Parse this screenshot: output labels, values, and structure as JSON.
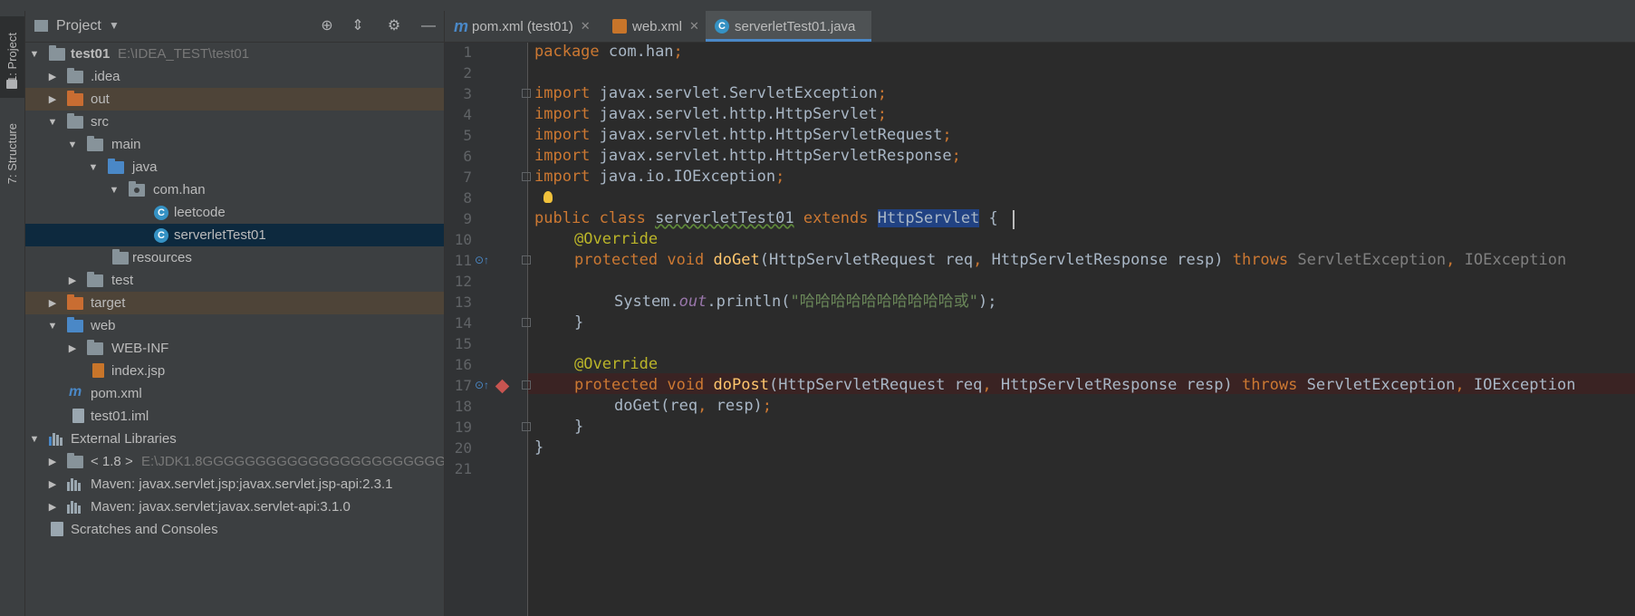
{
  "toolwindow_tabs": {
    "project": "1: Project",
    "structure": "7: Structure"
  },
  "project_panel": {
    "title": "Project",
    "tree": [
      {
        "label": "test01",
        "path": "E:\\IDEA_TEST\\test01"
      },
      {
        "label": ".idea"
      },
      {
        "label": "out"
      },
      {
        "label": "src"
      },
      {
        "label": "main"
      },
      {
        "label": "java"
      },
      {
        "label": "com.han"
      },
      {
        "label": "leetcode"
      },
      {
        "label": "serverletTest01"
      },
      {
        "label": "resources"
      },
      {
        "label": "test"
      },
      {
        "label": "target"
      },
      {
        "label": "web"
      },
      {
        "label": "WEB-INF"
      },
      {
        "label": "index.jsp"
      },
      {
        "label": "pom.xml"
      },
      {
        "label": "test01.iml"
      },
      {
        "label": "External Libraries"
      },
      {
        "label": "< 1.8 >",
        "path": "E:\\JDK1.8GGGGGGGGGGGGGGGGGGGGGGGGGG"
      },
      {
        "label": "Maven: javax.servlet.jsp:javax.servlet.jsp-api:2.3.1"
      },
      {
        "label": "Maven: javax.servlet:javax.servlet-api:3.1.0"
      },
      {
        "label": "Scratches and Consoles"
      }
    ]
  },
  "editor_tabs": [
    {
      "label": "pom.xml (test01)",
      "icon": "maven-icon"
    },
    {
      "label": "web.xml",
      "icon": "xml-icon"
    },
    {
      "label": "serverletTest01.java",
      "icon": "class-icon",
      "active": true
    }
  ],
  "code": {
    "line_numbers": [
      "1",
      "2",
      "3",
      "4",
      "5",
      "6",
      "7",
      "8",
      "9",
      "10",
      "11",
      "12",
      "13",
      "14",
      "15",
      "16",
      "17",
      "18",
      "19",
      "20",
      "21"
    ],
    "pkg_kw": "package",
    "pkg_name": " com.han",
    "semi": ";",
    "imp_kw": "import",
    "imports": [
      " javax.servlet.ServletException",
      " javax.servlet.http.HttpServlet",
      " javax.servlet.http.HttpServletRequest",
      " javax.servlet.http.HttpServletResponse",
      " java.io.IOException"
    ],
    "class_decl_kw": "public class ",
    "class_name": "serverletTest01",
    "extends_kw": " extends ",
    "super_class": "HttpServlet",
    "brace_open": " {",
    "override": "@Override",
    "protected_void": "protected void ",
    "doget": "doGet",
    "doget_params": "(HttpServletRequest req",
    "doget_params2": " HttpServletResponse resp) ",
    "throws_kw": "throws ",
    "doget_throws": "ServletException",
    "doget_throws2": " IOException",
    "comma": ",",
    "sys_out_1": "System.",
    "sys_out_2": "out",
    "sys_out_3": ".println(",
    "str_literal": "\"哈哈哈哈哈哈哈哈哈哈或\"",
    "sys_out_4": ");",
    "close_method": "}",
    "dopost": "doPost",
    "doget_call_1": "doGet(req",
    "doget_call_2": " resp)",
    "close_class": "}"
  }
}
